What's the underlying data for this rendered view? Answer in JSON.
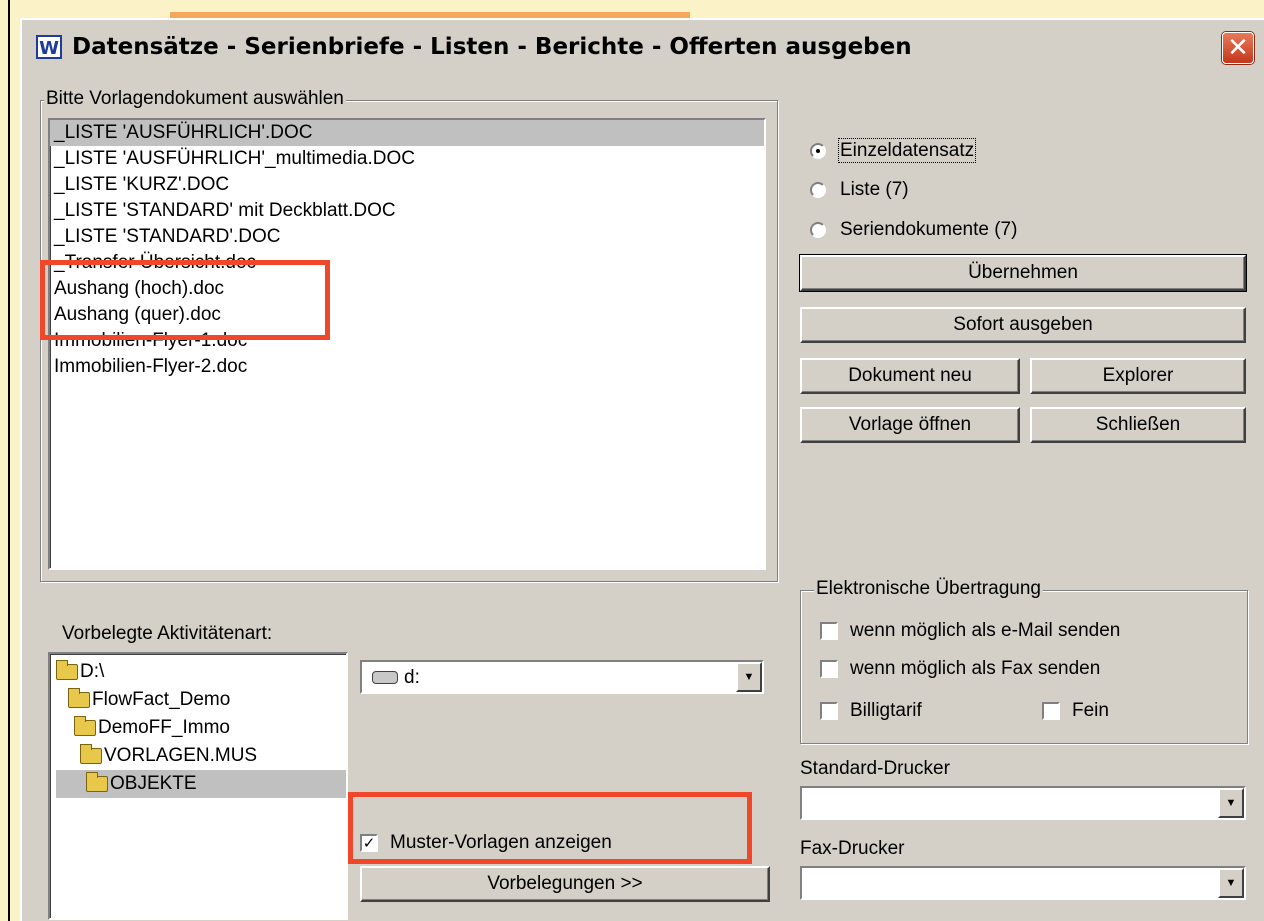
{
  "window": {
    "title": "Datensätze - Serienbriefe - Listen - Berichte - Offerten ausgeben",
    "app_icon_letter": "W",
    "close_symbol": "✕"
  },
  "templates": {
    "group_label": "Bitte Vorlagendokument auswählen",
    "items": [
      "_LISTE 'AUSFÜHRLICH'.DOC",
      "_LISTE 'AUSFÜHRLICH'_multimedia.DOC",
      "_LISTE 'KURZ'.DOC",
      "_LISTE 'STANDARD' mit Deckblatt.DOC",
      "_LISTE 'STANDARD'.DOC",
      "_Transfer Übersicht.doc",
      "Aushang (hoch).doc",
      "Aushang (quer).doc",
      "Immobilien-Flyer-1.doc",
      "Immobilien-Flyer-2.doc"
    ],
    "selected_index": 0
  },
  "output_mode": {
    "options": [
      "Einzeldatensatz",
      "Liste (7)",
      "Seriendokumente (7)"
    ],
    "selected_index": 0
  },
  "buttons": {
    "apply": "Übernehmen",
    "output_now": "Sofort ausgeben",
    "new_document": "Dokument neu",
    "explorer": "Explorer",
    "open_template": "Vorlage öffnen",
    "close": "Schließen",
    "presets": "Vorbelegungen >>"
  },
  "activity": {
    "label": "Vorbelegte Aktivitätenart:"
  },
  "folder_tree": {
    "items": [
      "D:\\",
      "FlowFact_Demo",
      "DemoFF_Immo",
      "VORLAGEN.MUS",
      "OBJEKTE"
    ],
    "selected_index": 4
  },
  "drive_select": {
    "value": "d:"
  },
  "show_samples": {
    "label": "Muster-Vorlagen anzeigen",
    "checked": true
  },
  "electronic": {
    "group_label": "Elektronische Übertragung",
    "email": {
      "label": "wenn möglich als e-Mail senden",
      "checked": false
    },
    "fax": {
      "label": "wenn möglich als Fax senden",
      "checked": false
    },
    "cheap_rate": {
      "label": "Billigtarif",
      "checked": false
    },
    "fine": {
      "label": "Fein",
      "checked": false
    }
  },
  "printers": {
    "standard_label": "Standard-Drucker",
    "standard_value": "",
    "fax_label": "Fax-Drucker",
    "fax_value": ""
  },
  "colors": {
    "highlight_box": "#f0472a",
    "dialog_bg": "#d4d0c8"
  }
}
